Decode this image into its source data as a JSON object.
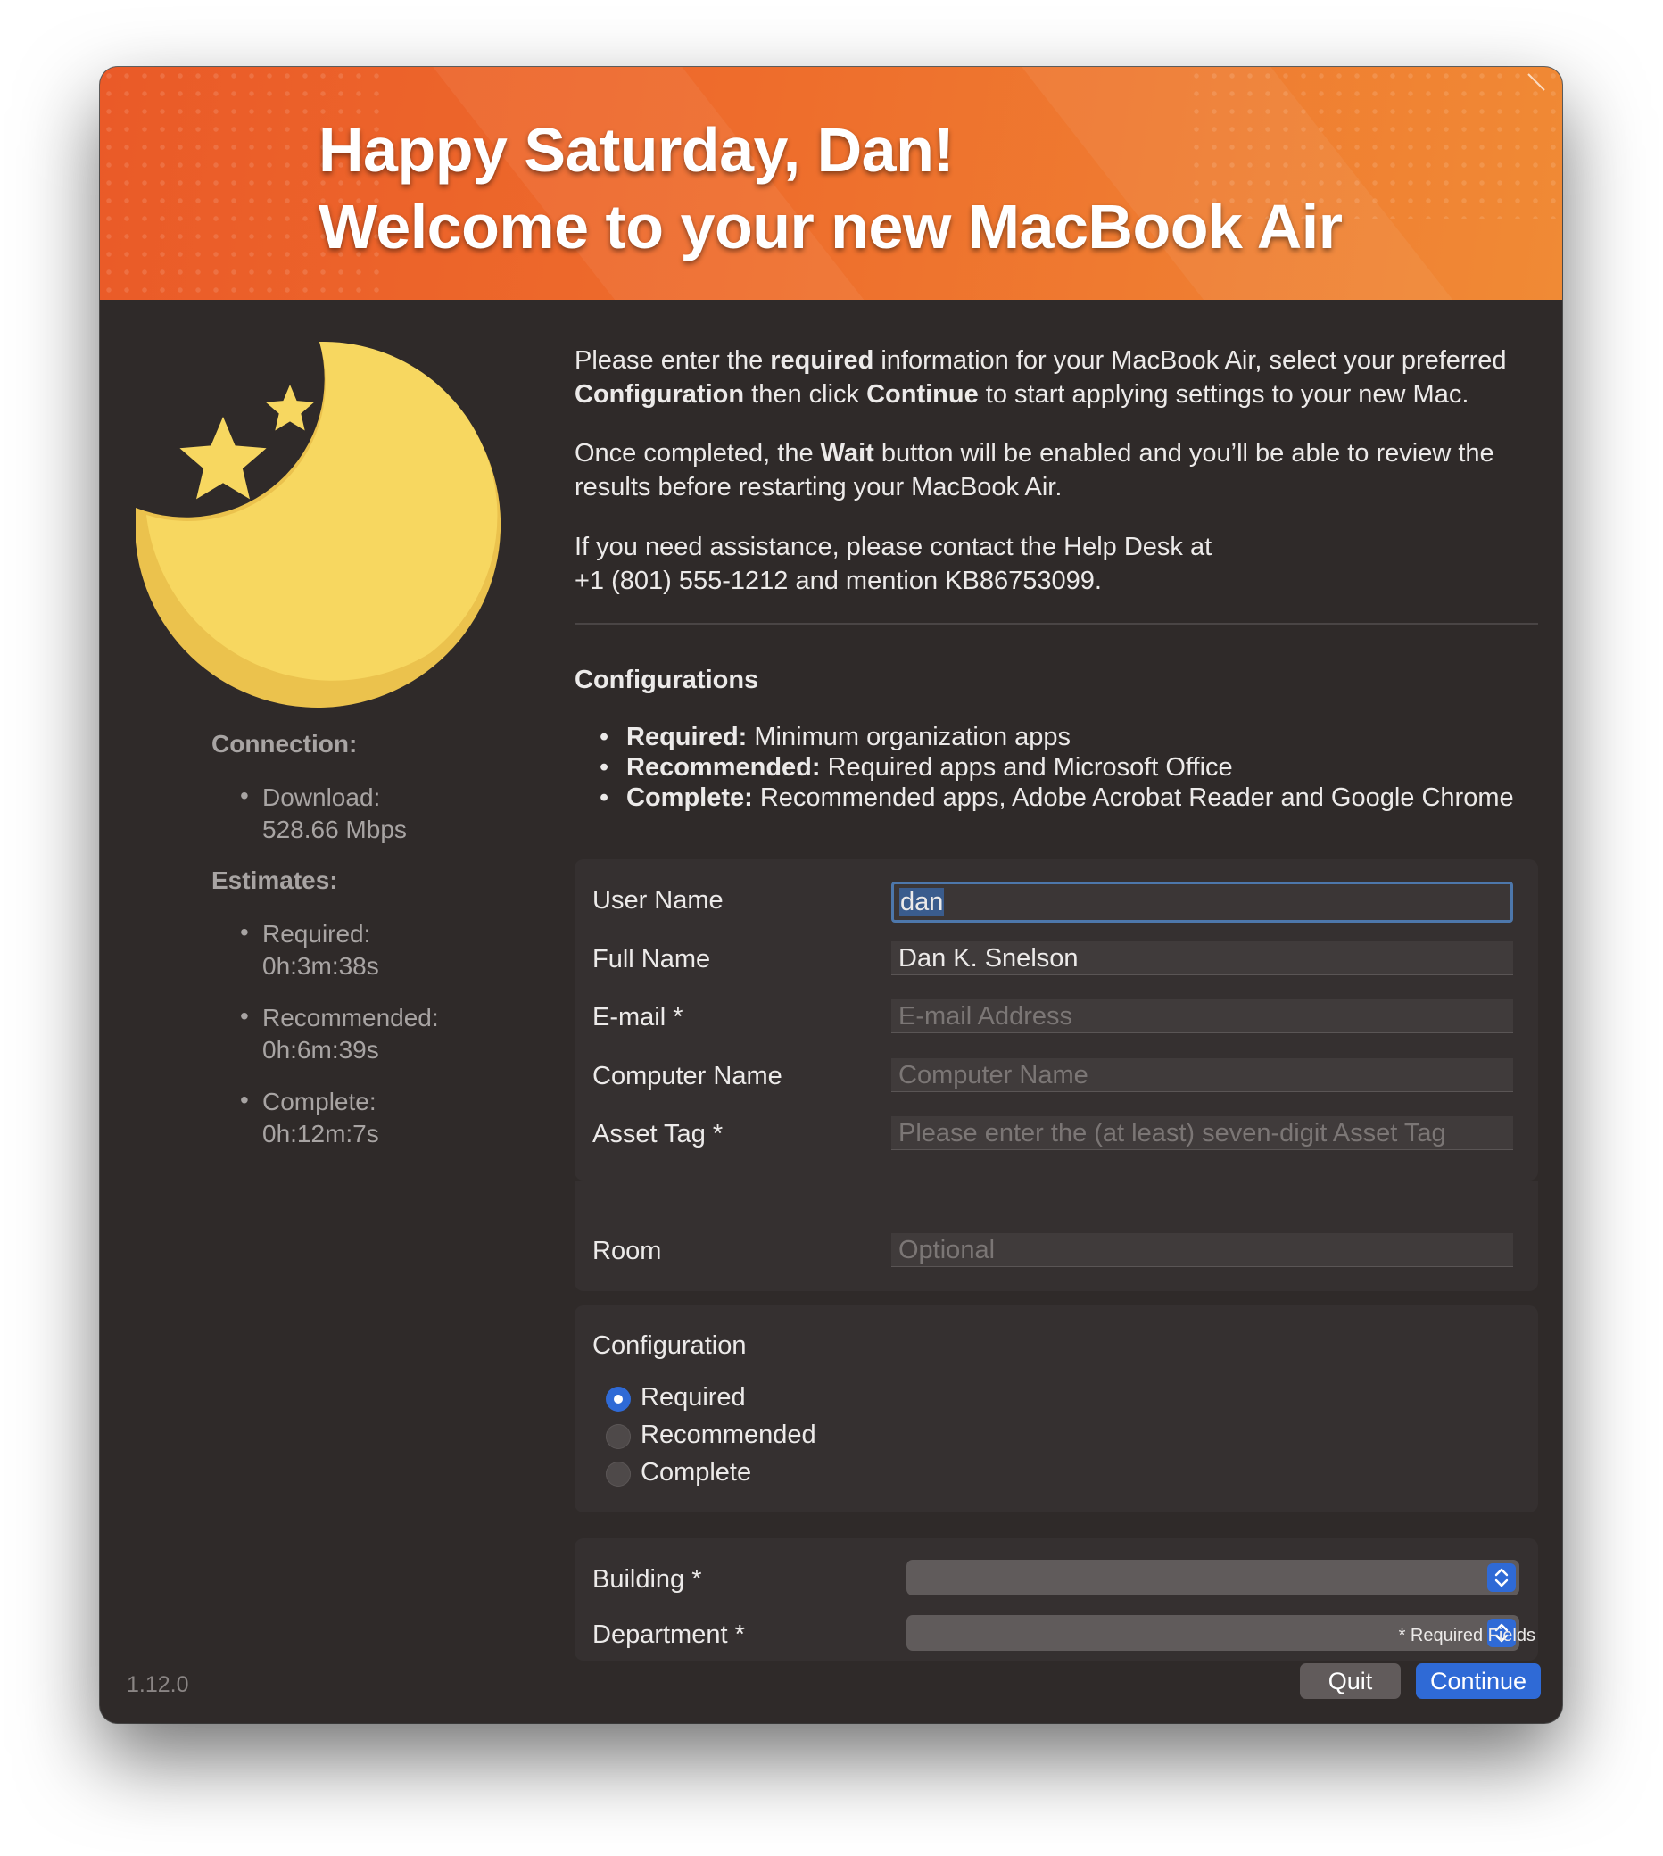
{
  "banner": {
    "line1": "Happy Saturday, Dan!",
    "line2": "Welcome to your new MacBook Air"
  },
  "colors": {
    "accent": "#2f6ad6",
    "banner_start": "#ea5a28",
    "banner_end": "#f08a35",
    "window_bg": "#2f2a29",
    "moon": "#f7d760"
  },
  "icons": {
    "hero": "moon-and-stars-icon"
  },
  "sidebar": {
    "connection_heading": "Connection:",
    "download_label": "Download:",
    "download_value": "528.66 Mbps",
    "estimates_heading": "Estimates:",
    "estimates": [
      {
        "label": "Required:",
        "value": "0h:3m:38s"
      },
      {
        "label": "Recommended:",
        "value": "0h:6m:39s"
      },
      {
        "label": "Complete:",
        "value": "0h:12m:7s"
      }
    ],
    "bullet": "•"
  },
  "intro": {
    "p1_a": "Please enter the ",
    "p1_b": "required",
    "p1_c": " information for your MacBook Air, select your preferred",
    "p1_d": "Configuration",
    "p1_e": " then click ",
    "p1_f": "Continue",
    "p1_g": " to start applying settings to your new Mac.",
    "p2_a": "Once completed, the ",
    "p2_b": "Wait",
    "p2_c": " button will be enabled and you’ll be able to review the",
    "p2_d": "results before restarting your MacBook Air.",
    "p3_a": "If you need assistance, please contact the Help Desk at",
    "p3_b": "+1 (801) 555-1212 and mention KB86753099."
  },
  "configurations": {
    "heading": "Configurations",
    "items": [
      {
        "name": "Required:",
        "desc": " Minimum organization apps"
      },
      {
        "name": "Recommended:",
        "desc": " Required apps and Microsoft Office"
      },
      {
        "name": "Complete:",
        "desc": " Recommended apps, Adobe Acrobat Reader and Google Chrome"
      }
    ]
  },
  "form": {
    "fields": [
      {
        "label": "User Name",
        "value": "dan",
        "placeholder": ""
      },
      {
        "label": "Full Name",
        "value": "Dan K. Snelson",
        "placeholder": ""
      },
      {
        "label": "E-mail *",
        "value": "",
        "placeholder": "E-mail Address"
      },
      {
        "label": "Computer Name",
        "value": "",
        "placeholder": "Computer Name"
      },
      {
        "label": "Asset Tag *",
        "value": "",
        "placeholder": "Please enter the (at least) seven-digit Asset Tag"
      },
      {
        "label": "Room",
        "value": "",
        "placeholder": "Optional"
      }
    ]
  },
  "configuration_radio": {
    "title": "Configuration",
    "options": [
      "Required",
      "Recommended",
      "Complete"
    ],
    "selected": "Required"
  },
  "selects": [
    {
      "label": "Building *",
      "value": ""
    },
    {
      "label": "Department *",
      "value": ""
    }
  ],
  "footer": {
    "required_note": "* Required Fields",
    "version": "1.12.0",
    "quit_label": "Quit",
    "continue_label": "Continue"
  }
}
